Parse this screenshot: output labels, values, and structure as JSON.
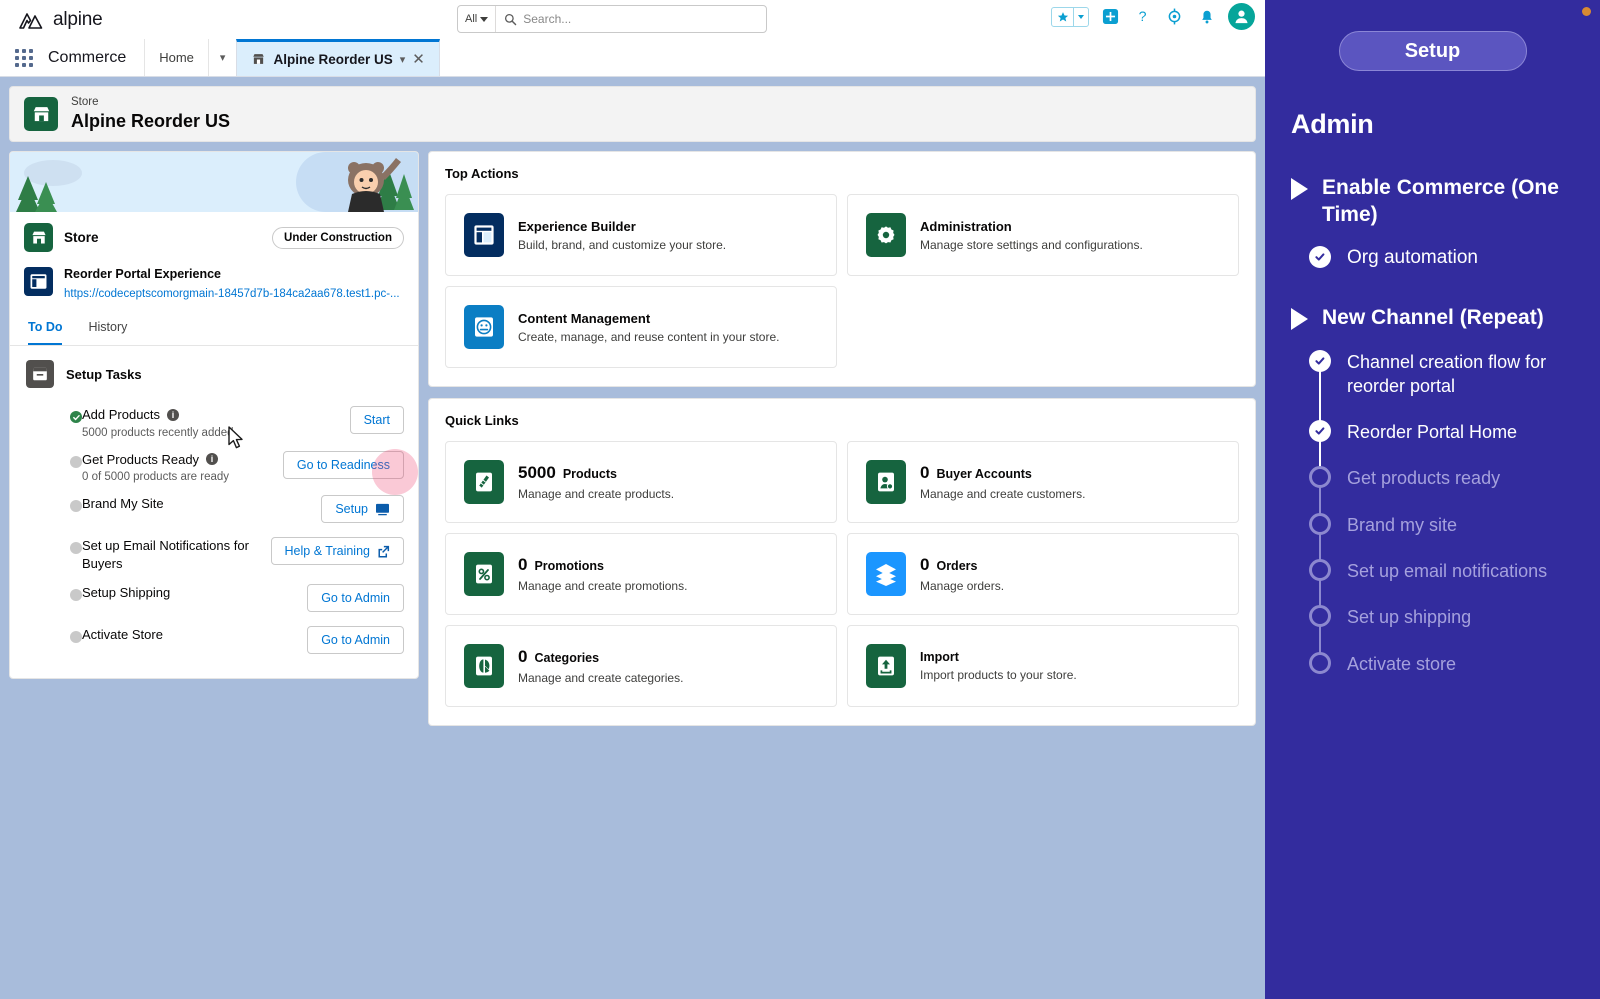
{
  "header": {
    "brand": "alpine",
    "search": {
      "scope": "All",
      "placeholder": "Search..."
    },
    "icons": [
      "favorites-star-icon",
      "favorites-dropdown-icon",
      "add-icon",
      "help-icon",
      "setup-gear-icon",
      "notifications-bell-icon",
      "user-avatar"
    ]
  },
  "tabbar": {
    "app_name": "Commerce",
    "home_tab": "Home",
    "active_tab": "Alpine Reorder US"
  },
  "record": {
    "eyebrow": "Store",
    "title": "Alpine Reorder US"
  },
  "store_panel": {
    "store_label": "Store",
    "status_pill": "Under Construction",
    "experience_title": "Reorder Portal Experience",
    "experience_url": "https://codeceptscomorgmain-18457d7b-184ca2aa678.test1.pc-...",
    "tabs": [
      {
        "label": "To Do",
        "selected": true
      },
      {
        "label": "History",
        "selected": false
      }
    ],
    "tasks_heading": "Setup Tasks",
    "tasks": [
      {
        "name": "Add Products",
        "info": true,
        "sub": "5000 products recently added",
        "status": "done",
        "button": "Start",
        "button_icon": ""
      },
      {
        "name": "Get Products Ready",
        "info": true,
        "sub": "0 of 5000 products are ready",
        "status": "todo",
        "button": "Go to Readiness",
        "button_icon": ""
      },
      {
        "name": "Brand My Site",
        "info": false,
        "sub": "",
        "status": "todo",
        "button": "Setup",
        "button_icon": "monitor-icon"
      },
      {
        "name": "Set up Email Notifications for Buyers",
        "info": false,
        "sub": "",
        "status": "todo",
        "button": "Help & Training",
        "button_icon": "external-link-icon"
      },
      {
        "name": "Setup Shipping",
        "info": false,
        "sub": "",
        "status": "todo",
        "button": "Go to Admin",
        "button_icon": ""
      },
      {
        "name": "Activate Store",
        "info": false,
        "sub": "",
        "status": "todo",
        "button": "Go to Admin",
        "button_icon": ""
      }
    ]
  },
  "top_actions": {
    "title": "Top Actions",
    "items": [
      {
        "title": "Experience Builder",
        "desc": "Build, brand, and customize your store.",
        "icon": "layout-builder-icon",
        "color": "#032d60"
      },
      {
        "title": "Administration",
        "desc": "Manage store settings and configurations.",
        "icon": "gear-icon",
        "color": "#16643f"
      },
      {
        "title": "Content Management",
        "desc": "Create, manage, and reuse content in your store.",
        "icon": "content-icon",
        "color": "#0b7ec4"
      }
    ]
  },
  "quick_links": {
    "title": "Quick Links",
    "items": [
      {
        "count": "5000",
        "label": "Products",
        "desc": "Manage and create products.",
        "icon": "products-icon",
        "color": "#16643f"
      },
      {
        "count": "0",
        "label": "Buyer Accounts",
        "desc": "Manage and create customers.",
        "icon": "buyer-accounts-icon",
        "color": "#16643f"
      },
      {
        "count": "0",
        "label": "Promotions",
        "desc": "Manage and create promotions.",
        "icon": "promotions-icon",
        "color": "#16643f"
      },
      {
        "count": "0",
        "label": "Orders",
        "desc": "Manage orders.",
        "icon": "orders-icon",
        "color": "#1b96ff"
      },
      {
        "count": "0",
        "label": "Categories",
        "desc": "Manage and create categories.",
        "icon": "categories-icon",
        "color": "#16643f"
      },
      {
        "count": "",
        "label": "Import",
        "desc": "Import products to your store.",
        "icon": "import-icon",
        "color": "#16643f"
      }
    ]
  },
  "sidebar": {
    "setup_button": "Setup",
    "heading": "Admin",
    "sections": [
      {
        "title": "Enable Commerce (One Time)",
        "steps": [
          {
            "label": "Org automation",
            "state": "done"
          }
        ]
      },
      {
        "title": "New Channel (Repeat)",
        "steps": [
          {
            "label": "Channel creation flow for reorder portal",
            "state": "done"
          },
          {
            "label": "Reorder Portal Home",
            "state": "done"
          },
          {
            "label": "Get products ready",
            "state": "todo"
          },
          {
            "label": "Brand my site",
            "state": "todo"
          },
          {
            "label": "Set up email notifications",
            "state": "todo"
          },
          {
            "label": "Set up shipping",
            "state": "todo"
          },
          {
            "label": "Activate store",
            "state": "todo"
          }
        ]
      }
    ],
    "colors": {
      "background": "#332c9e",
      "button": "#5b55c0",
      "muted_text": "#a5a1dd"
    }
  }
}
